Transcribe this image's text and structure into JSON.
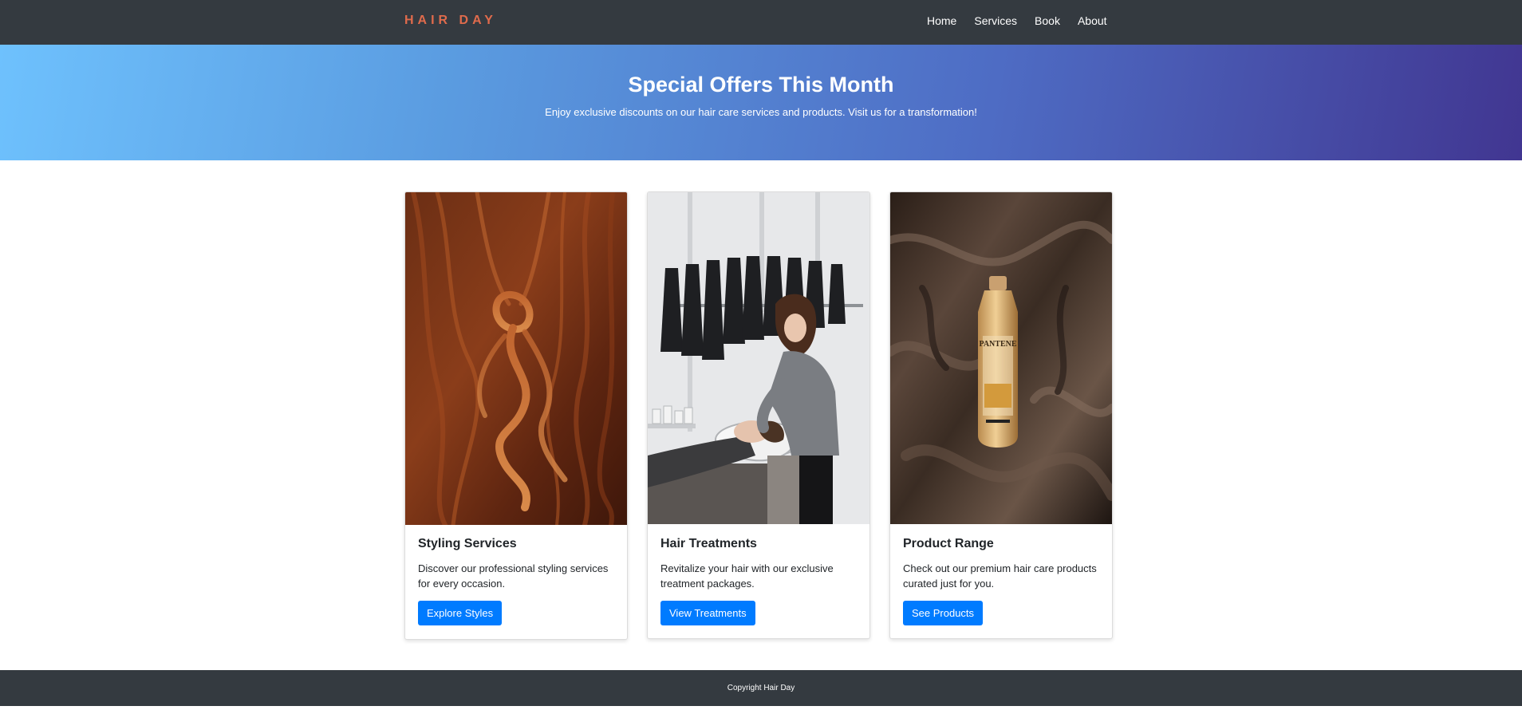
{
  "nav": {
    "brand": "HAIR DAY",
    "links": [
      "Home",
      "Services",
      "Book",
      "About"
    ]
  },
  "hero": {
    "title": "Special Offers This Month",
    "text": "Enjoy exclusive discounts on our hair care services and products. Visit us for a transformation!"
  },
  "cards": [
    {
      "title": "Styling Services",
      "text": "Discover our professional styling services for every occasion.",
      "button": "Explore Styles",
      "image": "red-hair-braid-photo"
    },
    {
      "title": "Hair Treatments",
      "text": "Revitalize your hair with our exclusive treatment packages.",
      "button": "View Treatments",
      "image": "salon-hair-wash-photo"
    },
    {
      "title": "Product Range",
      "text": "Check out our premium hair care products curated just for you.",
      "button": "See Products",
      "image": "shampoo-bottle-on-silk-photo",
      "image_label": "PANTENE"
    }
  ],
  "footer": {
    "text": "Copyright Hair Day"
  },
  "colors": {
    "navbar": "#343a40",
    "brand": "#e06b4c",
    "button": "#007bff",
    "hero_start": "#6ec1fd",
    "hero_end": "#413691"
  }
}
